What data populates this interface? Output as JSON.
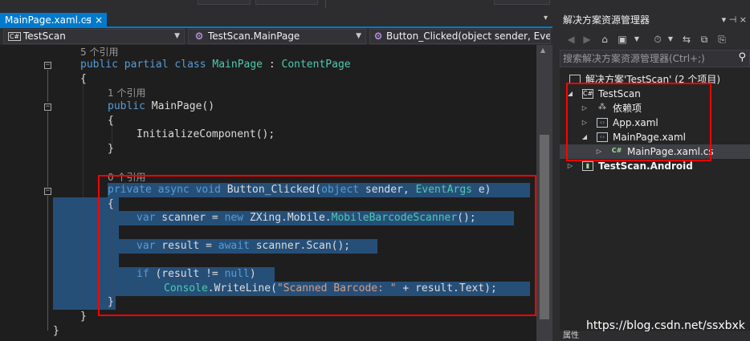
{
  "editor": {
    "tab_title": "MainPage.xaml.cs",
    "tab_pin": "⊣",
    "tab_close": "×",
    "tab_dropdown": "▾",
    "nav": {
      "project": "TestScan",
      "project_icon": "C#",
      "class_name": "TestScan.MainPage",
      "member": "Button_Clicked(object sender, EventArgs e)"
    },
    "code": {
      "refs_class": "5 个引用",
      "class_kw1": "public",
      "class_kw2": "partial",
      "class_kw3": "class",
      "class_name": "MainPage",
      "class_colon": " : ",
      "class_base": "ContentPage",
      "brace_open": "{",
      "brace_close": "}",
      "refs_ctor": "1 个引用",
      "ctor_kw": "public",
      "ctor_sig": " MainPage()",
      "init_call": "InitializeComponent();",
      "refs_method": "0 个引用",
      "m_kw1": "private",
      "m_kw2": "async",
      "m_kw3": "void",
      "m_name": " Button_Clicked(",
      "m_kw4": "object",
      "m_param1": " sender, ",
      "m_type": "EventArgs",
      "m_param2": " e)",
      "l1_var": "var",
      "l1_mid": " scanner = ",
      "l1_new": "new",
      "l1_ns": " ZXing.Mobile.",
      "l1_type": "MobileBarcodeScanner",
      "l1_end": "();",
      "l2_var": "var",
      "l2_mid": " result = ",
      "l2_await": "await",
      "l2_end": " scanner.Scan();",
      "l3_if": "if",
      "l3_mid": " (result != ",
      "l3_null": "null",
      "l3_end": ")",
      "l4_console": "Console",
      "l4_mid": ".WriteLine(",
      "l4_str": "\"Scanned Barcode: \"",
      "l4_end": " + result.Text);"
    }
  },
  "explorer": {
    "title": "解决方案资源管理器",
    "search_placeholder": "搜索解决方案资源管理器(Ctrl+;)",
    "items": [
      {
        "label": "解决方案'TestScan' (2 个项目)",
        "icon": "solution-icon"
      },
      {
        "label": "TestScan",
        "icon": "csharp-project-icon"
      },
      {
        "label": "依赖项",
        "icon": "dependencies-icon"
      },
      {
        "label": "App.xaml",
        "icon": "xaml-file-icon"
      },
      {
        "label": "MainPage.xaml",
        "icon": "xaml-file-icon"
      },
      {
        "label": "MainPage.xaml.cs",
        "icon": "csharp-file-icon"
      },
      {
        "label": "TestScan.Android",
        "icon": "android-project-icon"
      }
    ],
    "bottom_label": "属性"
  },
  "watermark": "https://blog.csdn.net/ssxbxk",
  "colors": {
    "accent": "#007acc",
    "selection": "#264f78",
    "highlight_box": "#ff0000",
    "keyword": "#569cd6",
    "type": "#4ec9b0",
    "string": "#d69d85"
  }
}
